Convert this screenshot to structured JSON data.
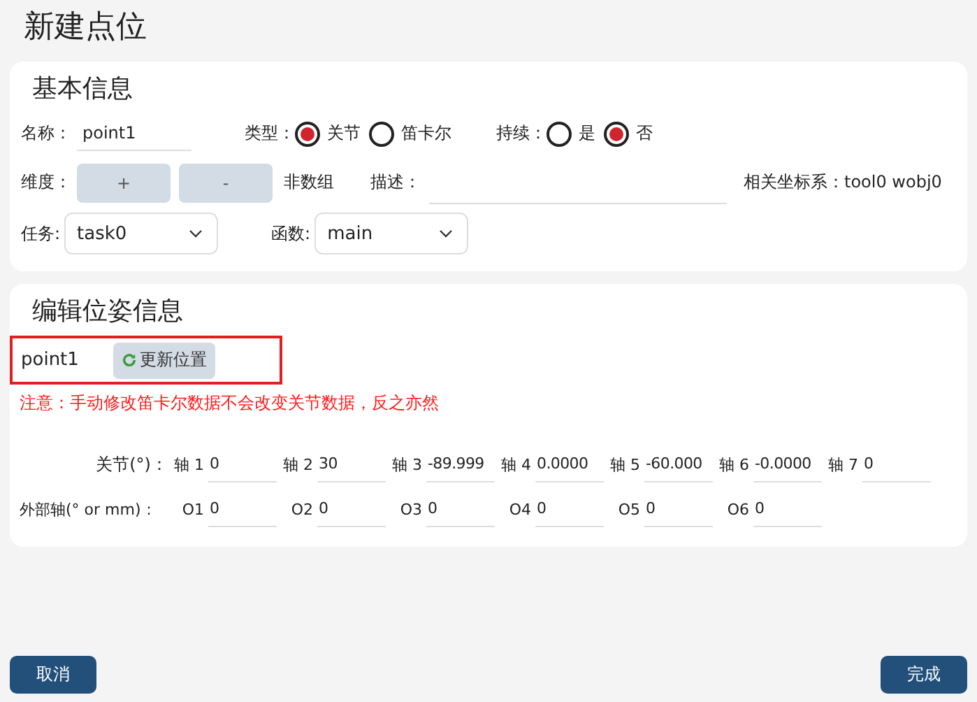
{
  "page_title": "新建点位",
  "basic_info": {
    "title": "基本信息",
    "name": {
      "label": "名称：",
      "value": "point1"
    },
    "type": {
      "label": "类型：",
      "options": [
        {
          "label": "关节",
          "selected": true
        },
        {
          "label": "笛卡尔",
          "selected": false
        }
      ]
    },
    "continuous": {
      "label": "持续：",
      "options": [
        {
          "label": "是",
          "selected": false
        },
        {
          "label": "否",
          "selected": true
        }
      ]
    },
    "dimension": {
      "label": "维度：",
      "buttons": [
        "+",
        "-"
      ],
      "note": "非数组"
    },
    "description": {
      "label": "描述："
    },
    "coord_system": "相关坐标系：tool0  wobj0",
    "task": {
      "label": "任务:",
      "value": "task0"
    },
    "function": {
      "label": "函数:",
      "value": "main"
    }
  },
  "pose": {
    "title": "编辑位姿信息",
    "point_name": "point1",
    "update_button": "更新位置",
    "warning": "注意：手动修改笛卡尔数据不会改变关节数据，反之亦然",
    "joints": {
      "label": "关节(°)：",
      "axes": [
        {
          "label": "轴 1",
          "value": "0"
        },
        {
          "label": "轴 2",
          "value": "30"
        },
        {
          "label": "轴 3",
          "value": "-89.999"
        },
        {
          "label": "轴 4",
          "value": "0.0000"
        },
        {
          "label": "轴 5",
          "value": "-60.000"
        },
        {
          "label": "轴 6",
          "value": "-0.0000"
        },
        {
          "label": "轴 7",
          "value": "0"
        }
      ]
    },
    "external": {
      "label": "外部轴(° or mm)：",
      "axes": [
        {
          "label": "O1",
          "value": "0"
        },
        {
          "label": "O2",
          "value": "0"
        },
        {
          "label": "O3",
          "value": "0"
        },
        {
          "label": "O4",
          "value": "0"
        },
        {
          "label": "O5",
          "value": "0"
        },
        {
          "label": "O6",
          "value": "0"
        }
      ]
    }
  },
  "footer": {
    "cancel": "取消",
    "done": "完成"
  }
}
